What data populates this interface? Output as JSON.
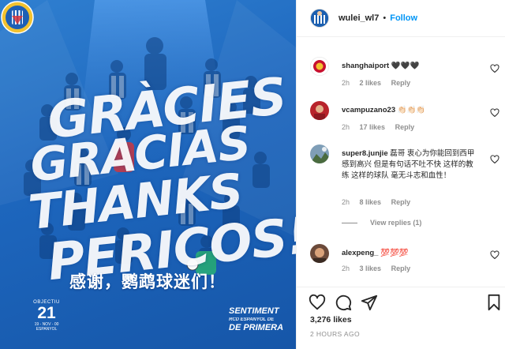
{
  "post": {
    "image_text": {
      "line1": "GRÀCIES",
      "line2": "GRACIAS",
      "line3": "THANKS",
      "line4": "PERICOS!",
      "chinese": "感谢，鹦鹉球迷们！",
      "objectiu_label": "OBJECTIU",
      "objectiu_number": "21",
      "objectiu_date": "19 - NOV - 00",
      "objectiu_team": "ESPANYOL",
      "sentiment_line1": "SENTIMENT",
      "sentiment_line2": "RCD ESPANYOL DE",
      "sentiment_line3": "DE PRIMERA"
    }
  },
  "header": {
    "username": "wulei_wl7",
    "separator": "•",
    "follow_label": "Follow"
  },
  "comments": [
    {
      "username": "shanghaiport",
      "text": "🖤🖤🖤",
      "time": "2h",
      "likes": "2 likes",
      "reply": "Reply"
    },
    {
      "username": "vcampuzano23",
      "text": "👏🏻👏🏻👏🏻",
      "time": "2h",
      "likes": "17 likes",
      "reply": "Reply"
    },
    {
      "username": "super8.junjie",
      "text": "磊哥 衷心为你能回到西甲感到高兴 但是有句话不吐不快 这样的教练 这样的球队 毫无斗志和血性！",
      "time": "2h",
      "likes": "8 likes",
      "reply": "Reply"
    },
    {
      "username": "alexpeng_",
      "text": "💯💯💯",
      "time": "2h",
      "likes": "3 likes",
      "reply": "Reply"
    }
  ],
  "view_replies": "View replies (1)",
  "actions": {
    "like_icon": "heart-icon",
    "comment_icon": "comment-icon",
    "share_icon": "share-icon",
    "save_icon": "bookmark-icon"
  },
  "likes_count": "3,276 likes",
  "timestamp": "2 HOURS AGO",
  "colors": {
    "follow_blue": "#0095f6",
    "meta_gray": "#8e8e8e",
    "image_blue": "#1d66bd"
  }
}
